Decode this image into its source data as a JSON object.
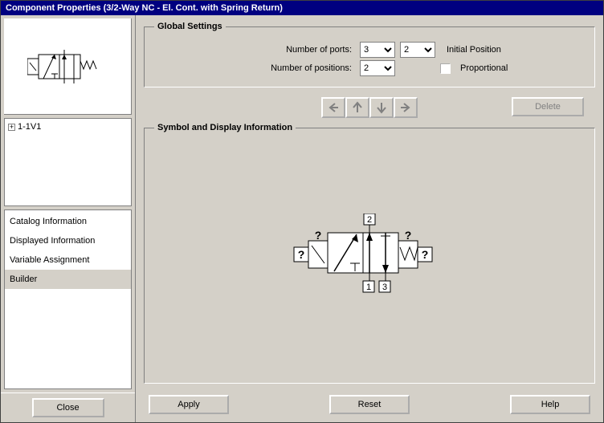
{
  "window": {
    "title": "Component Properties (3/2-Way NC - El. Cont. with Spring Return)"
  },
  "tree": {
    "root_label": "1-1V1"
  },
  "nav": {
    "items": [
      {
        "label": "Catalog Information",
        "selected": false
      },
      {
        "label": "Displayed Information",
        "selected": false
      },
      {
        "label": "Variable Assignment",
        "selected": false
      },
      {
        "label": "Builder",
        "selected": true
      }
    ]
  },
  "left": {
    "close_label": "Close"
  },
  "global": {
    "legend": "Global Settings",
    "ports_label": "Number of ports:",
    "positions_label": "Number of positions:",
    "ports_value": "3",
    "initial_position_value": "2",
    "positions_value": "2",
    "initial_position_label": "Initial Position",
    "proportional_label": "Proportional",
    "delete_label": "Delete"
  },
  "symbol": {
    "legend": "Symbol and Display Information",
    "port_labels": {
      "top": "2",
      "bottom_left": "1",
      "bottom_right": "3"
    }
  },
  "footer": {
    "apply_label": "Apply",
    "reset_label": "Reset",
    "help_label": "Help"
  }
}
